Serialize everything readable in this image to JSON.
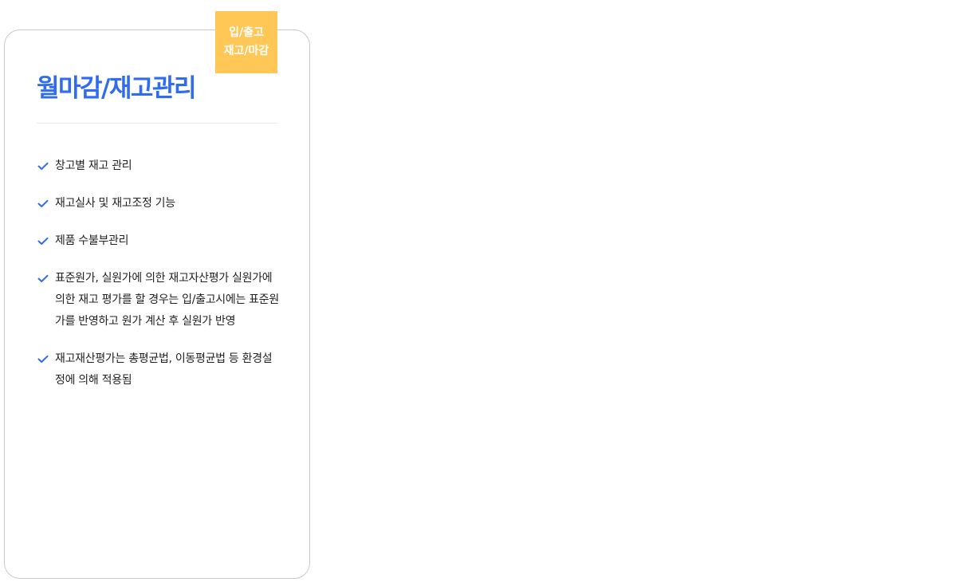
{
  "badge": {
    "line1": "입/출고",
    "line2": "재고/마감"
  },
  "card": {
    "title": "월마감/재고관리",
    "features": [
      "창고별 재고 관리",
      "재고실사 및 재고조정 기능",
      "제품 수불부관리",
      "표준원가, 실원가에 의한 재고자산평가 실원가에 의한 재고 평가를 할 경우는 입/출고시에는 표준원가를 반영하고 원가 계산 후 실원가 반영",
      "재고재산평가는 총평균법, 이동평균법 등 환경설정에 의해 적용됨"
    ],
    "icon": "check-icon"
  },
  "colors": {
    "accent": "#2f6cf0",
    "badge": "#fec756",
    "border": "#c9c9c9"
  }
}
